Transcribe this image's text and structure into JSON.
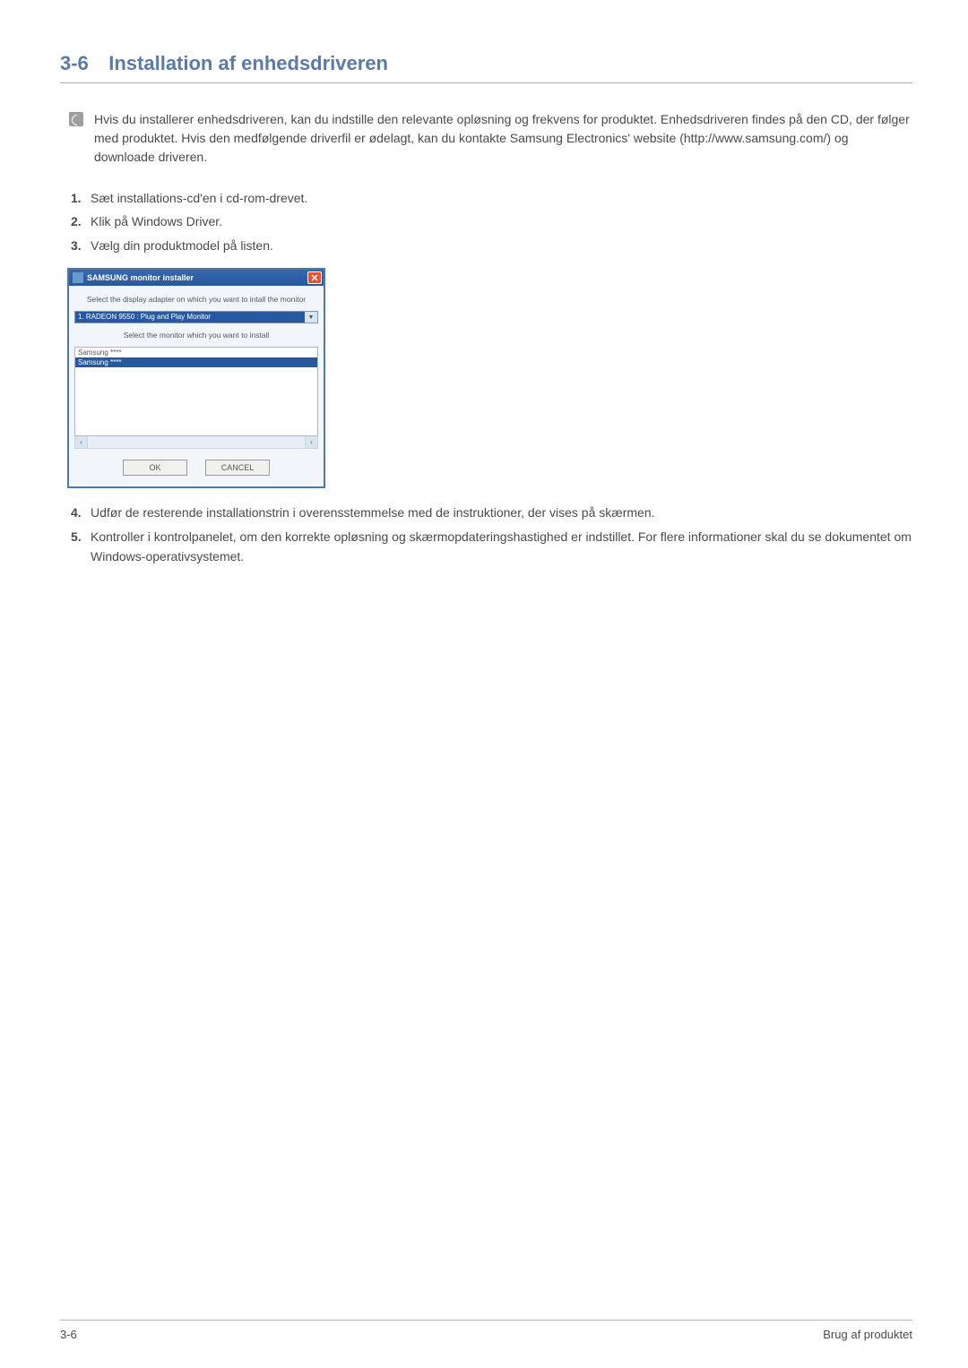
{
  "header": {
    "section_number": "3-6",
    "section_title": "Installation af enhedsdriveren"
  },
  "note": {
    "text": "Hvis du installerer enhedsdriveren, kan du indstille den relevante opløsning og frekvens for produktet. Enhedsdriveren findes på den CD, der følger med produktet. Hvis den medfølgende driverfil er ødelagt, kan du kontakte Samsung Electronics' website (http://www.samsung.com/) og downloade driveren."
  },
  "steps_a": [
    {
      "num": "1.",
      "text": "Sæt installations-cd'en i cd-rom-drevet."
    },
    {
      "num": "2.",
      "text": "Klik på Windows Driver."
    },
    {
      "num": "3.",
      "text": "Vælg din produktmodel på listen."
    }
  ],
  "installer": {
    "title": "SAMSUNG monitor installer",
    "label1": "Select the display adapter on which you want to intall the monitor",
    "dropdown_value": "1. RADEON 9550 : Plug and Play Monitor",
    "label2": "Select the monitor which you want to install",
    "monitor_items": [
      "Samsung ****",
      "Samsung ****"
    ],
    "ok_label": "OK",
    "cancel_label": "CANCEL"
  },
  "steps_b": [
    {
      "num": "4.",
      "text": "Udfør de resterende installationstrin i overensstemmelse med de instruktioner, der vises på skærmen."
    },
    {
      "num": "5.",
      "text": "Kontroller i kontrolpanelet, om den korrekte opløsning og skærmopdateringshastighed er indstillet. For flere informationer skal du se dokumentet om Windows-operativsystemet."
    }
  ],
  "footer": {
    "left": "3-6",
    "right": "Brug af produktet"
  }
}
